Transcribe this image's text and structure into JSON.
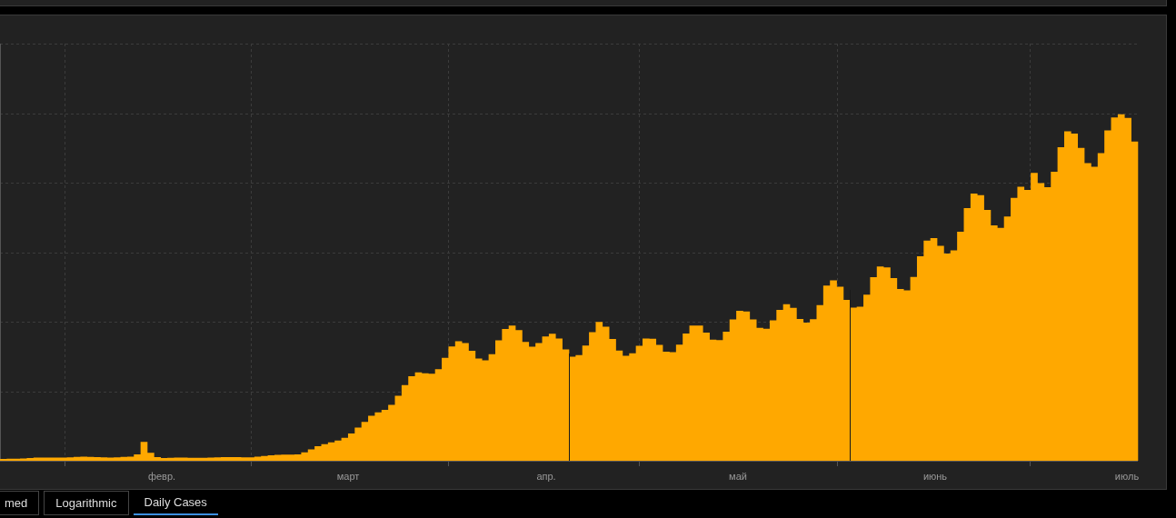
{
  "chart": {
    "x_labels": [
      "февр.",
      "март",
      "апр.",
      "май",
      "июнь",
      "июль"
    ]
  },
  "tabs": [
    {
      "label": "med",
      "selected": false
    },
    {
      "label": "Logarithmic",
      "selected": false
    },
    {
      "label": "Daily Cases",
      "selected": true
    }
  ]
}
